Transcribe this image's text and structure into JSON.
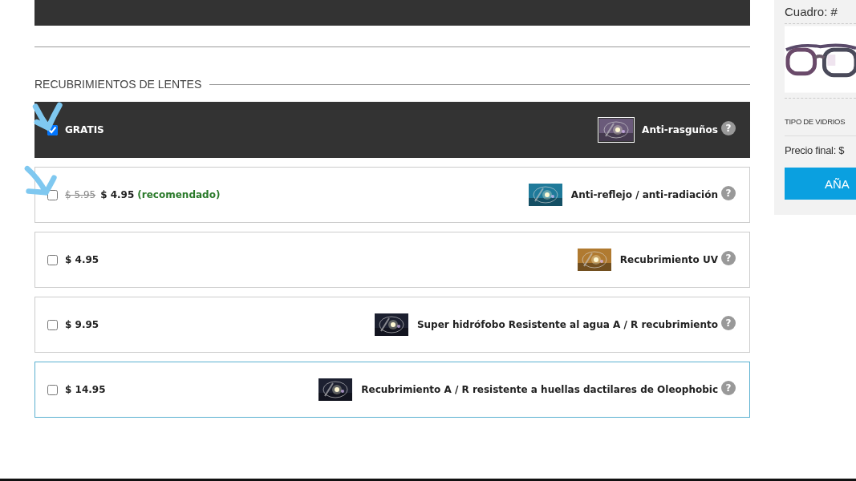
{
  "section": {
    "title": "RECUBRIMIENTOS DE LENTES"
  },
  "options": [
    {
      "checked": true,
      "hovered": false,
      "price": "GRATIS",
      "name": "Anti-rasguños",
      "help": "?"
    },
    {
      "checked": false,
      "hovered": false,
      "old_price": "$ 5.95",
      "price": "$ 4.95",
      "note": "(recomendado)",
      "name": "Anti-reflejo / anti-radiación",
      "help": "?"
    },
    {
      "checked": false,
      "hovered": false,
      "price": "$ 4.95",
      "name": "Recubrimiento UV",
      "help": "?"
    },
    {
      "checked": false,
      "hovered": false,
      "price": "$ 9.95",
      "name": "Super hidrófobo Resistente al agua A / R recubrimiento",
      "help": "?"
    },
    {
      "checked": false,
      "hovered": true,
      "price": "$ 14.95",
      "name": "Recubrimiento A / R resistente a huellas dactilares de Oleophobic",
      "help": "?"
    }
  ],
  "sidebar": {
    "frame_label": "Cuadro: #",
    "lens_type": "TIPO DE VIDRIOS",
    "final_price": "Precio final: $",
    "add_button": "AÑA"
  }
}
